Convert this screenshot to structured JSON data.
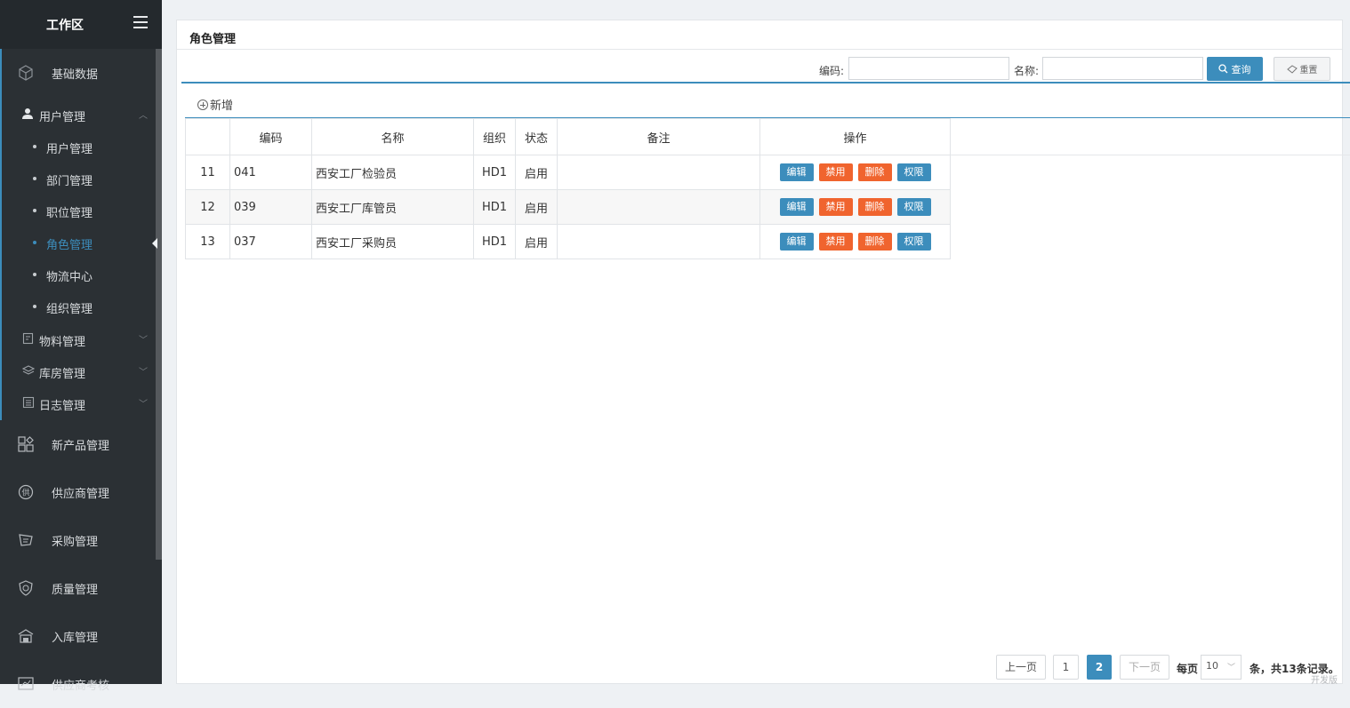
{
  "sidebar": {
    "title": "工作区",
    "groups_top": [
      {
        "label": "基础数据",
        "icon": "cube-icon"
      }
    ],
    "user_mgmt": {
      "label": "用户管理",
      "items": [
        {
          "label": "用户管理"
        },
        {
          "label": "部门管理"
        },
        {
          "label": "职位管理"
        },
        {
          "label": "角色管理",
          "active": true
        },
        {
          "label": "物流中心"
        },
        {
          "label": "组织管理"
        }
      ]
    },
    "subs": [
      {
        "label": "物料管理",
        "icon": "material-icon"
      },
      {
        "label": "库房管理",
        "icon": "layers-icon"
      },
      {
        "label": "日志管理",
        "icon": "log-icon"
      }
    ],
    "groups_bottom": [
      {
        "label": "新产品管理",
        "icon": "apps-icon"
      },
      {
        "label": "供应商管理",
        "icon": "supplier-icon"
      },
      {
        "label": "采购管理",
        "icon": "purchase-icon"
      },
      {
        "label": "质量管理",
        "icon": "quality-shield-icon"
      },
      {
        "label": "入库管理",
        "icon": "warehouse-icon"
      },
      {
        "label": "供应商考核",
        "icon": "assessment-icon"
      }
    ]
  },
  "page": {
    "title": "角色管理"
  },
  "search": {
    "code_label": "编码:",
    "name_label": "名称:",
    "code_value": "",
    "name_value": "",
    "query_label": "查询",
    "reset_label": "重置"
  },
  "toolbar": {
    "add_label": "新增"
  },
  "table": {
    "headers": [
      "",
      "编码",
      "名称",
      "组织",
      "状态",
      "备注",
      "操作"
    ],
    "rows": [
      {
        "idx": "11",
        "code": "041",
        "name": "西安工厂检验员",
        "org": "HD1",
        "status": "启用",
        "remark": ""
      },
      {
        "idx": "12",
        "code": "039",
        "name": "西安工厂库管员",
        "org": "HD1",
        "status": "启用",
        "remark": ""
      },
      {
        "idx": "13",
        "code": "037",
        "name": "西安工厂采购员",
        "org": "HD1",
        "status": "启用",
        "remark": ""
      }
    ],
    "actions": {
      "edit": "编辑",
      "disable": "禁用",
      "delete": "删除",
      "perm": "权限"
    }
  },
  "pagination": {
    "prev": "上一页",
    "pages": [
      "1",
      "2"
    ],
    "current": "2",
    "next": "下一页",
    "per_page_label": "每页",
    "per_page_value": "10",
    "summary": "条，共13条记录。"
  },
  "footer": {
    "edition": "开发版"
  },
  "colors": {
    "accent": "#3c8dbc",
    "danger": "#f0642e",
    "sidebar_bg": "#2b3034"
  }
}
